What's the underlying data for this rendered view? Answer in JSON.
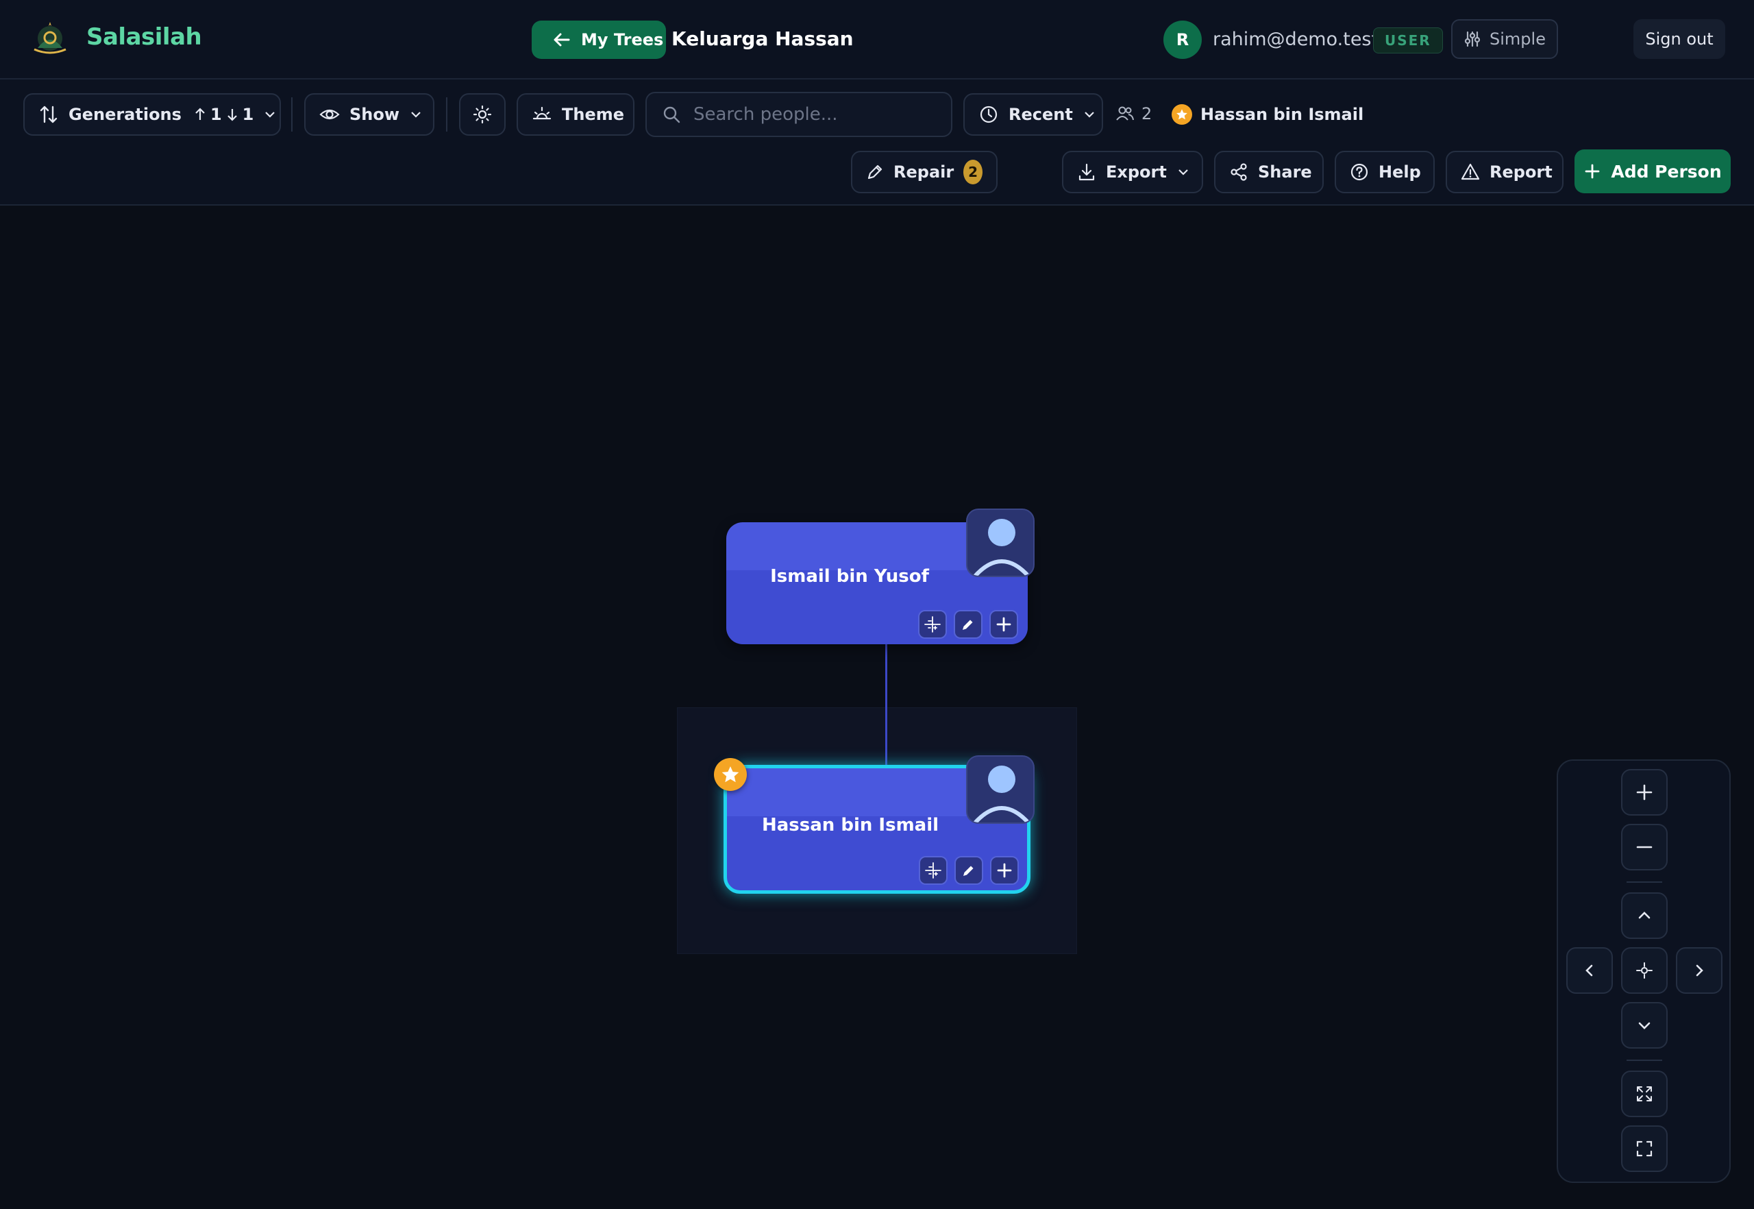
{
  "header": {
    "brand": "Salasilah",
    "my_trees_label": "My Trees",
    "tree_title": "Keluarga Hassan",
    "user_initial": "R",
    "user_email": "rahim@demo.test",
    "user_role": "USER",
    "mode_label": "Simple",
    "sign_out_label": "Sign out"
  },
  "toolbar": {
    "generations_label": "Generations",
    "gen_up": "1",
    "gen_down": "1",
    "show_label": "Show",
    "theme_label": "Theme",
    "search_placeholder": "Search people...",
    "recent_label": "Recent",
    "people_count": "2",
    "focus_person": "Hassan bin Ismail",
    "repair_label": "Repair",
    "repair_count": "2",
    "export_label": "Export",
    "share_label": "Share",
    "help_label": "Help",
    "report_label": "Report",
    "add_person_label": "Add Person"
  },
  "tree": {
    "nodes": [
      {
        "name": "Ismail bin Yusof",
        "focused": false
      },
      {
        "name": "Hassan bin Ismail",
        "focused": true
      }
    ]
  },
  "colors": {
    "accent_green": "#0d6e4a",
    "node_blue": "#4a58de",
    "focus_cyan": "#22d3ee",
    "focus_star": "#f5a524"
  }
}
